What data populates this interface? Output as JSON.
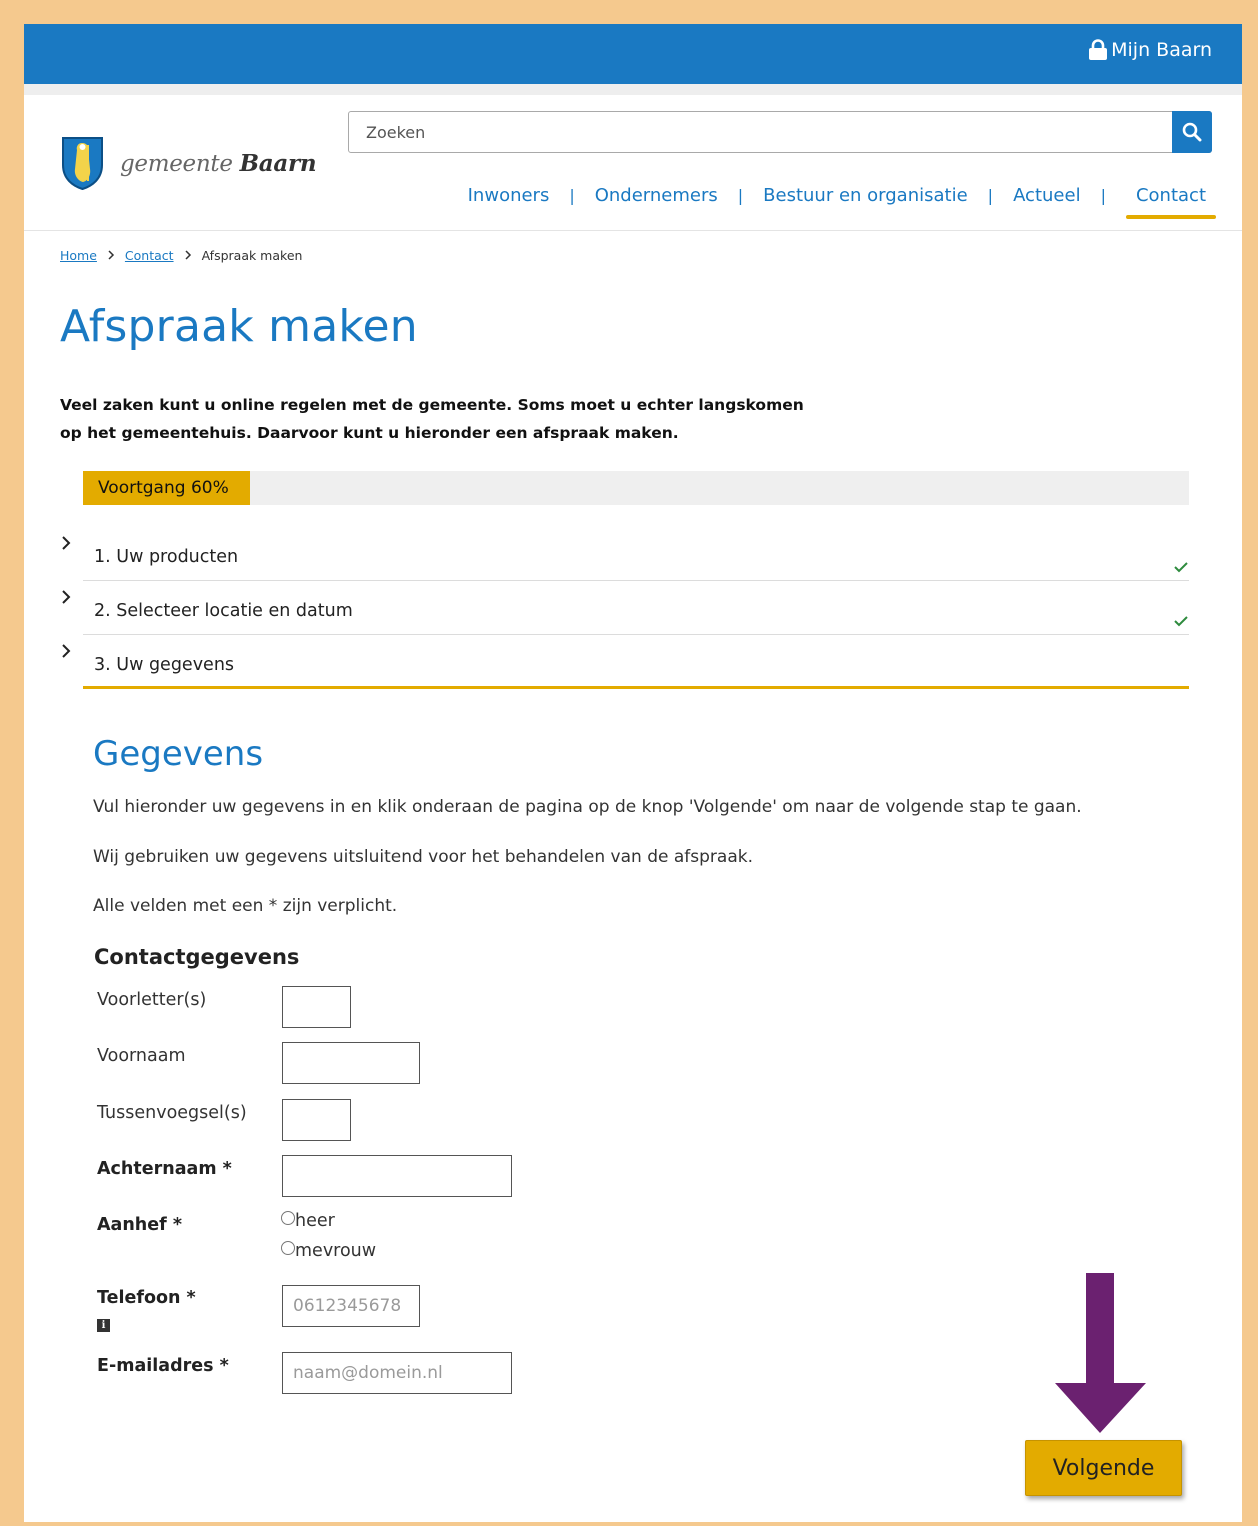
{
  "topbar": {
    "account_link": "Mijn Baarn",
    "account_icon": "lock-icon"
  },
  "logo": {
    "prefix": "gemeente",
    "name": "Baarn"
  },
  "search": {
    "placeholder": "Zoeken",
    "button_icon": "search-icon"
  },
  "nav": {
    "items": [
      "Inwoners",
      "Ondernemers",
      "Bestuur en organisatie",
      "Actueel",
      "Contact"
    ],
    "separator": "|",
    "active": "Contact"
  },
  "breadcrumb": {
    "home": "Home",
    "contact": "Contact",
    "current": "Afspraak maken"
  },
  "page_title": "Afspraak maken",
  "intro": "Veel zaken kunt u online regelen met de gemeente. Soms moet u echter langskomen op het gemeentehuis. Daarvoor kunt u hieronder een afspraak maken.",
  "progress": {
    "label": "Voortgang 60%",
    "fraction": 0.6,
    "color": "#e3ab00"
  },
  "steps": [
    {
      "label": "1. Uw producten",
      "completed": true
    },
    {
      "label": "2. Selecteer locatie en datum",
      "completed": true
    },
    {
      "label": "3. Uw gegevens",
      "completed": false
    }
  ],
  "section": {
    "title": "Gegevens",
    "p1": "Vul hieronder uw gegevens in en klik onderaan de pagina op de knop 'Volgende' om naar de volgende stap te gaan.",
    "p2": "Wij gebruiken uw gegevens uitsluitend voor het behandelen van de afspraak.",
    "p3": "Alle velden met een * zijn verplicht."
  },
  "form": {
    "heading": "Contactgegevens",
    "voorletters_label": "Voorletter(s)",
    "voornaam_label": "Voornaam",
    "tussenvoegsel_label": "Tussenvoegsel(s)",
    "achternaam_label": "Achternaam  *",
    "aanhef_label": "Aanhef  *",
    "aanhef_options": [
      "heer",
      "mevrouw"
    ],
    "telefoon_label": "Telefoon  *",
    "telefoon_placeholder": "0612345678",
    "telefoon_info_icon": "info-icon",
    "email_label": "E-mailadres  *",
    "email_placeholder": "naam@domein.nl"
  },
  "next_button": "Volgende",
  "colors": {
    "brand_blue": "#1a79c2",
    "accent_gold": "#e3ab00",
    "arrow_purple": "#6b2170",
    "frame": "#f5c98e"
  }
}
